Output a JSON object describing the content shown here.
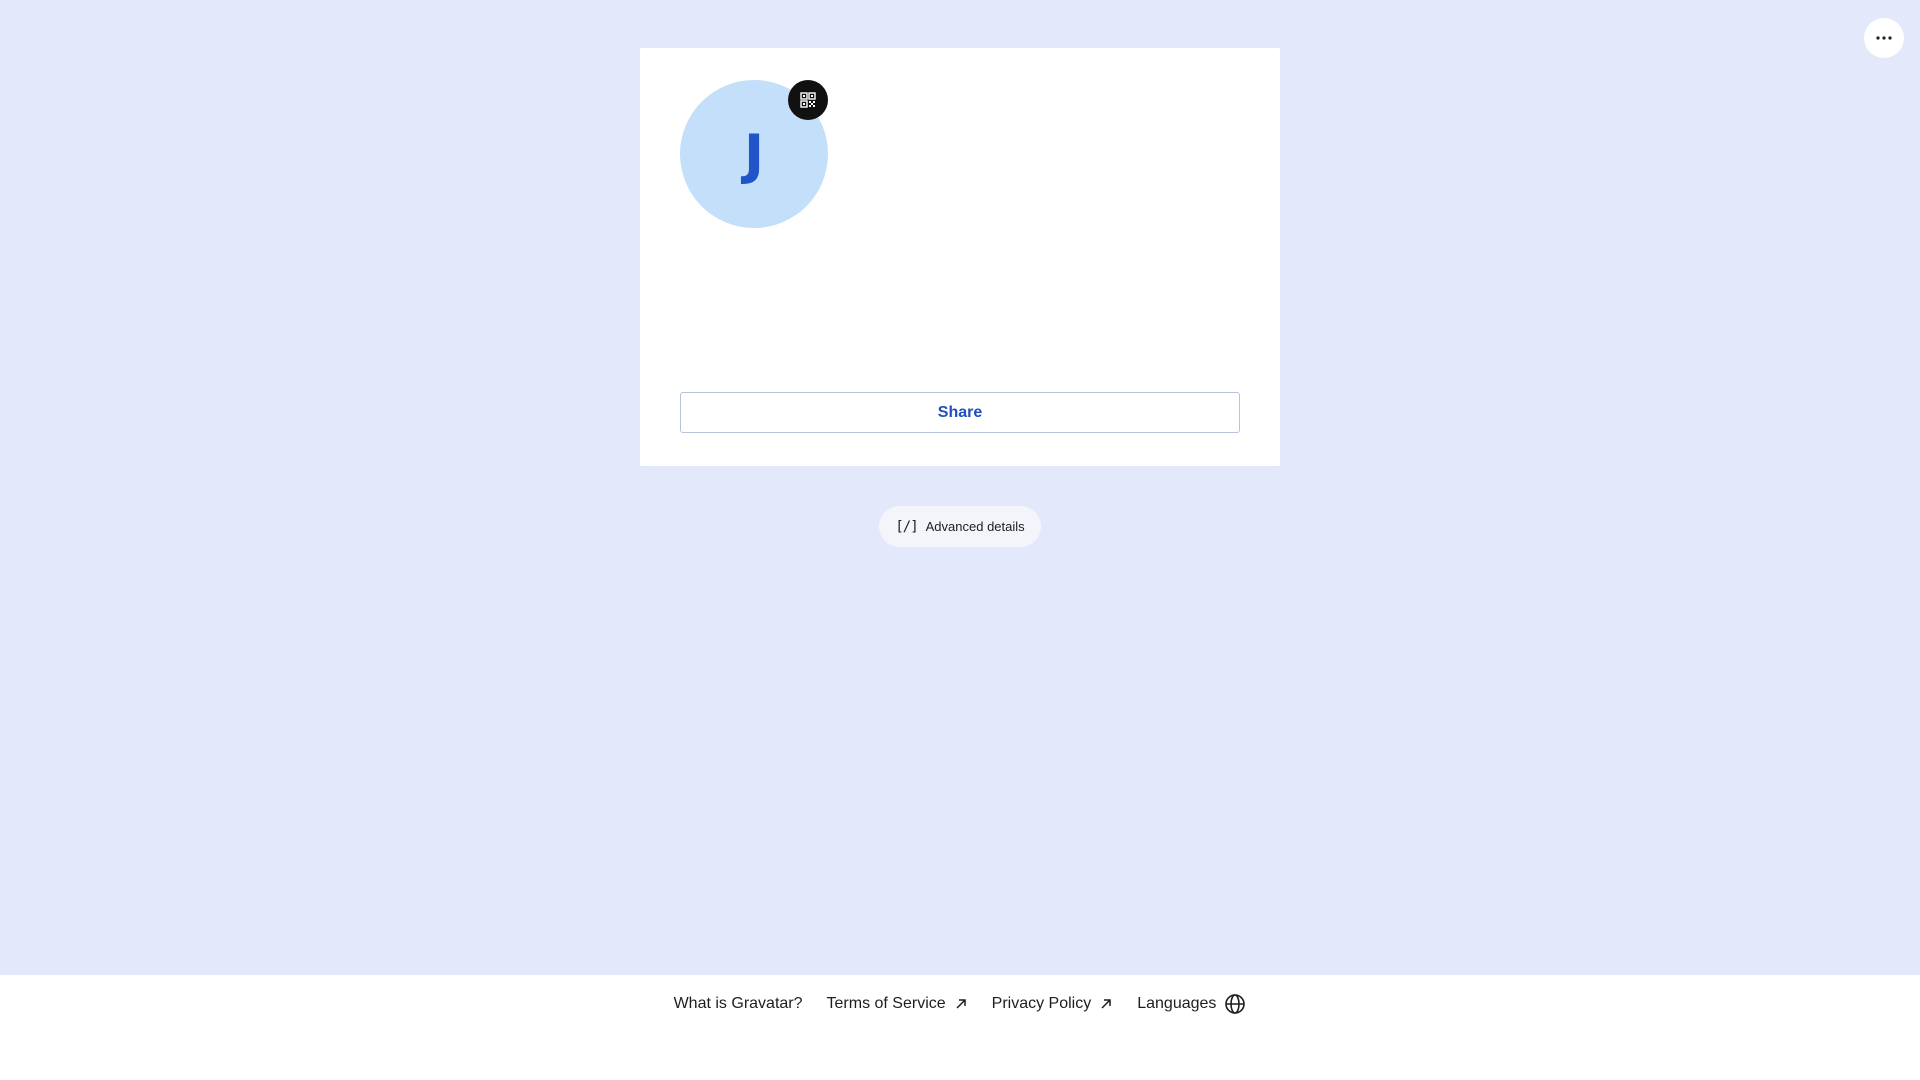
{
  "profile": {
    "initial": "J",
    "avatar_bg": "#c4dffa",
    "avatar_text_color": "#2054c8"
  },
  "actions": {
    "more_icon": "ellipsis-icon",
    "qr_icon": "qr-code-icon",
    "share_label": "Share",
    "advanced_label": "Advanced details",
    "advanced_icon": "code-icon",
    "advanced_icon_glyph": "[/]"
  },
  "footer": {
    "links": [
      {
        "label": "What is Gravatar?"
      },
      {
        "label": "Terms of Service",
        "icon": "external-link-icon"
      },
      {
        "label": "Privacy Policy",
        "icon": "external-link-icon"
      },
      {
        "label": "Languages",
        "icon": "globe-icon"
      }
    ]
  },
  "colors": {
    "page_bg": "#e3e9fa",
    "accent": "#1f4fbf",
    "footer_bg": "#ffffff"
  }
}
